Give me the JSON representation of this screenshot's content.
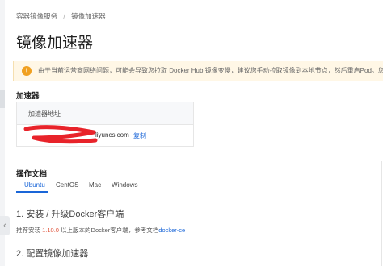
{
  "breadcrumb": {
    "items": [
      "容器镜像服务",
      "镜像加速器"
    ]
  },
  "page": {
    "title": "镜像加速器"
  },
  "notice": {
    "icon": "info-icon",
    "text": "由于当前运营商网络问题，可能会导致您拉取 Docker Hub 镜像变慢，建议您手动拉取镜像到本地节点，然后重启Pod。您也可以"
  },
  "accelerator": {
    "section_label": "加速器",
    "column_header": "加速器地址",
    "url_visible": "liyuncs.com",
    "copy_label": "复制"
  },
  "docs": {
    "section_label": "操作文档",
    "tabs": [
      "Ubuntu",
      "CentOS",
      "Mac",
      "Windows"
    ],
    "active_tab": "Ubuntu"
  },
  "steps": {
    "step1_title": "1. 安装 / 升级Docker客户端",
    "step1_prefix": "推荐安装 ",
    "step1_version": "1.10.0",
    "step1_middle": " 以上版本的Docker客户端，参考文档",
    "step1_link": "docker-ce",
    "step2_title": "2. 配置镜像加速器"
  },
  "colors": {
    "accent": "#1a66d8",
    "warning_bg": "#fff7e6",
    "warning_icon": "#f0a020",
    "redaction": "#e8232a"
  }
}
